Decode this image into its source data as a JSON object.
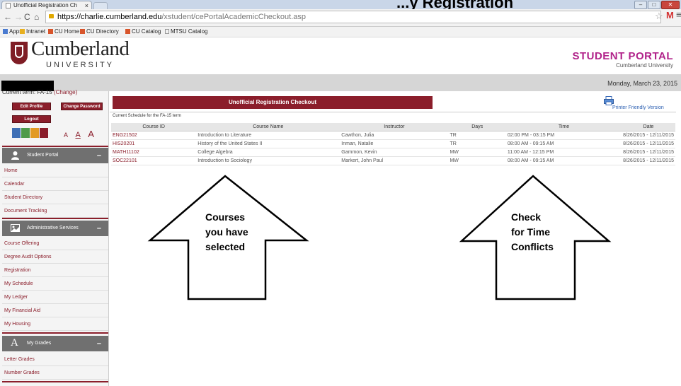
{
  "browser": {
    "tab_title": "Unofficial Registration Ch",
    "tab_close": "×",
    "url_host": "https://charlie.cumberland.edu",
    "url_path": "/xstudent/cePortalAcademicCheckout.asp",
    "bookmarks": [
      "Apps",
      "Intranet",
      "CU Home",
      "CU Directory",
      "CU Catalog",
      "MTSU Catalog"
    ]
  },
  "overlay_title": "...y Registration",
  "header": {
    "logo_name": "Cumberland",
    "logo_sub": "UNIVERSITY",
    "portal_title": "STUDENT PORTAL",
    "portal_sub": "Cumberland University",
    "date": "Monday, March 23, 2015"
  },
  "sidebar": {
    "term_prefix": "Current term: FA-15",
    "term_change": "(Change)",
    "buttons": {
      "edit_profile": "Edit Profile",
      "change_password": "Change Password",
      "logout": "Logout"
    },
    "font_sizes": [
      "A",
      "A",
      "A"
    ],
    "colors": [
      "#3f6fb5",
      "#4e9a4a",
      "#e29a24",
      "#8b1e2b"
    ],
    "sections": [
      {
        "title": "Student Portal",
        "items": [
          "Home",
          "Calendar",
          "Student Directory",
          "Document Tracking"
        ]
      },
      {
        "title": "Administrative Services",
        "items": [
          "Course Offering",
          "Degree Audit Options",
          "Registration",
          "My Schedule",
          "My Ledger",
          "My Financial Aid",
          "My Housing"
        ]
      },
      {
        "title": "My Grades",
        "items": [
          "Letter Grades",
          "Number Grades"
        ]
      }
    ]
  },
  "main": {
    "title": "Unofficial Registration Checkout",
    "printer_link": "Printer Friendly Version",
    "caption": "Current Schedule for the FA-15 term",
    "columns": [
      "Course ID",
      "Course Name",
      "Instructor",
      "Days",
      "Time",
      "Date"
    ],
    "rows": [
      [
        "ENG21502",
        "Introduction to Literature",
        "Cawthon, Julia",
        "TR",
        "02:00 PM - 03:15 PM",
        "8/26/2015 - 12/11/2015"
      ],
      [
        "HIS20201",
        "History of the United States II",
        "Inman, Natalie",
        "TR",
        "08:00 AM - 09:15 AM",
        "8/26/2015 - 12/11/2015"
      ],
      [
        "MATH11102",
        "College Algebra",
        "Gammon, Kevin",
        "MW",
        "11:00 AM - 12:15 PM",
        "8/26/2015 - 12/11/2015"
      ],
      [
        "SOC22101",
        "Introduction to Sociology",
        "Markert, John Paul",
        "MW",
        "08:00 AM - 09:15 AM",
        "8/26/2015 - 12/11/2015"
      ]
    ]
  },
  "annotations": {
    "left_arrow": [
      "Courses",
      "you have",
      "selected"
    ],
    "right_arrow": [
      "Check",
      "for Time",
      "Conflicts"
    ]
  }
}
